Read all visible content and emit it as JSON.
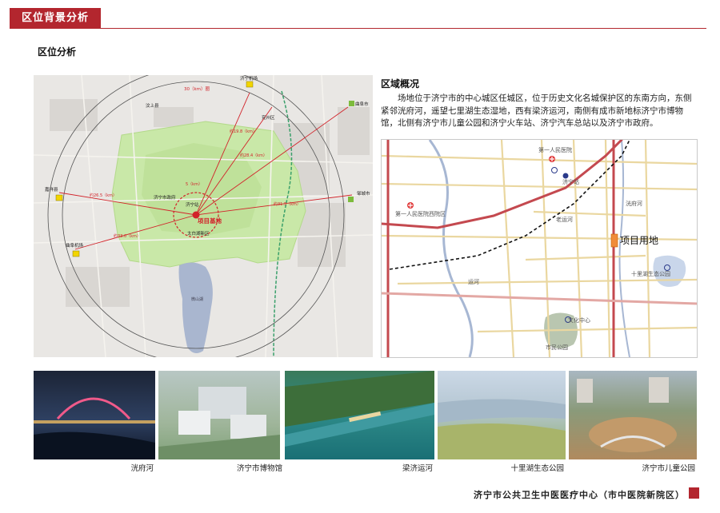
{
  "header": {
    "title": "区位背景分析"
  },
  "section": {
    "title": "区位分析"
  },
  "left_map": {
    "labels": {
      "airport_top": "济宁机场",
      "ring_30": "30（km）圈",
      "qufu_top": "曲阜市",
      "wenshang": "汶上县",
      "yanzhou": "兖州区",
      "jiaxiang": "嘉祥县",
      "zoucheng": "邹城市",
      "gov": "济宁市政府",
      "station": "济宁站",
      "taibai": "太白湖新区",
      "project": "项目基地",
      "qufu_airport": "曲阜机场",
      "weishan": "微山湖",
      "d_yanzhou": "约28.4（km）",
      "d_airport": "约19.8（km）",
      "d_jiaxiang": "约26.5（km）",
      "d_zoucheng": "约31.5（km）",
      "d_qufu_airport": "约33.0（km）",
      "d_5": "5（km）"
    }
  },
  "overview": {
    "title": "区域概况",
    "text": "场地位于济宁市的中心城区任城区，位于历史文化名城保护区的东南方向，东侧紧邻洸府河，遥望七里湖生态湿地，西有梁济运河，南侧有成市新地标济宁市博物馆，北侧有济宁市儿童公园和济宁火车站、济宁汽车总站以及济宁市政府。"
  },
  "right_map": {
    "labels": {
      "hospital1": "第一人民医院",
      "station": "济宁站",
      "hospital_west": "第一人民医院西院区",
      "guangfu": "洸府河",
      "laoyun": "老运河",
      "yunhe": "运河",
      "project": "项目用地",
      "qilihu": "十里湖生态公园",
      "culture": "文化中心",
      "park": "市民公园"
    }
  },
  "photos": [
    {
      "caption": "洸府河"
    },
    {
      "caption": "济宁市博物馆"
    },
    {
      "caption": "梁济运河"
    },
    {
      "caption": "十里湖生态公园"
    },
    {
      "caption": "济宁市儿童公园"
    }
  ],
  "footer": {
    "text": "济宁市公共卫生中医医疗中心（市中医院新院区）"
  },
  "colors": {
    "accent": "#b3262e",
    "map_green": "#c9e8a8",
    "lake": "#a9b6cf",
    "road_red": "#c4494f",
    "road_yellow": "#ead7a0"
  }
}
